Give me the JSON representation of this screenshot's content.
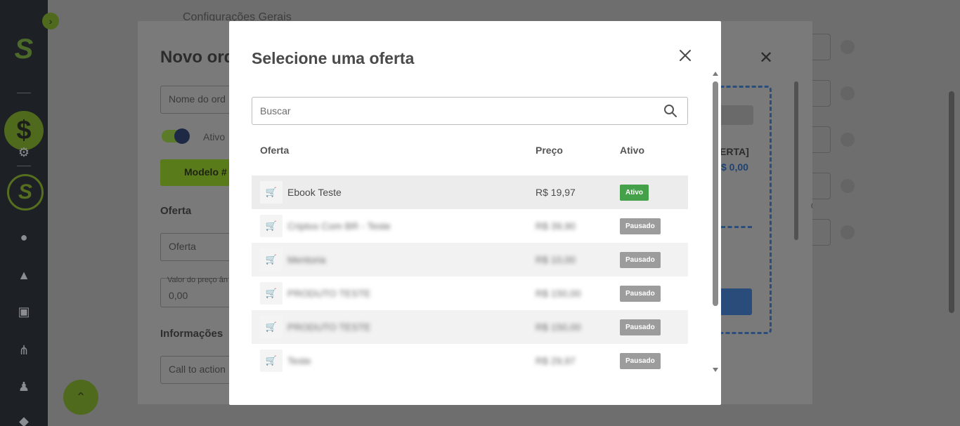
{
  "background": {
    "heading": "Configurações Gerais",
    "sidebar_icons": [
      "dollar-icon",
      "gear-icon",
      "logo-ring-icon",
      "chef-hat-icon",
      "shopping-bag-icon",
      "presentation-icon",
      "network-icon",
      "users-icon",
      "diamond-icon"
    ]
  },
  "middle_modal": {
    "title": "Novo ord",
    "name_placeholder": "Nome do ord",
    "toggle_label": "Ativo",
    "model_button": "Modelo #",
    "section_offer": "Oferta",
    "offer_placeholder": "Oferta",
    "price_label": "Valor do preço ân",
    "price_value": "0,00",
    "section_info": "Informações",
    "cta_placeholder": "Call to action",
    "preview_offer_text": "ERTA]",
    "preview_price": "$ 0,00",
    "side_value": "00"
  },
  "offer_modal": {
    "title": "Selecione uma oferta",
    "search_placeholder": "Buscar",
    "columns": {
      "offer": "Oferta",
      "price": "Preço",
      "active": "Ativo"
    },
    "rows": [
      {
        "name": "Ebook Teste",
        "price": "R$ 19,97",
        "status": "Ativo"
      },
      {
        "name": "Criptos Com BR - Teste",
        "price": "R$ 39,90",
        "status": "Pausado"
      },
      {
        "name": "Mentoria",
        "price": "R$ 10,00",
        "status": "Pausado"
      },
      {
        "name": "PRODUTO TESTE",
        "price": "R$ 150,00",
        "status": "Pausado"
      },
      {
        "name": "PRODUTO TESTE",
        "price": "R$ 150,00",
        "status": "Pausado"
      },
      {
        "name": "Teste",
        "price": "R$ 29,97",
        "status": "Pausado"
      }
    ]
  }
}
